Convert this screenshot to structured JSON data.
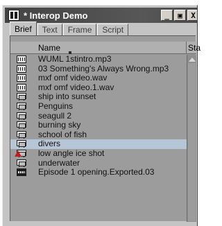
{
  "window": {
    "title": "* Interop Demo",
    "buttons": {
      "minimize": "_",
      "maximize": "▣",
      "close": "X"
    }
  },
  "tabs": [
    {
      "label": "Brief",
      "active": true
    },
    {
      "label": "Text",
      "active": false
    },
    {
      "label": "Frame",
      "active": false
    },
    {
      "label": "Script",
      "active": false
    }
  ],
  "columns": {
    "name": "Name",
    "status": "Sta"
  },
  "rows": [
    {
      "label": "WUML 1stintro.mp3",
      "icon": "audio-clip-icon",
      "selected": false
    },
    {
      "label": "03 Something's Always Wrong.mp3",
      "icon": "audio-clip-icon",
      "selected": false
    },
    {
      "label": "mxf omf video.wav",
      "icon": "audio-clip-icon",
      "selected": false
    },
    {
      "label": "mxf omf video.1.wav",
      "icon": "audio-clip-icon",
      "selected": false
    },
    {
      "label": "ship into sunset",
      "icon": "video-clip-icon",
      "selected": false
    },
    {
      "label": "Penguins",
      "icon": "video-clip-icon",
      "selected": false
    },
    {
      "label": "seagull 2",
      "icon": "video-clip-icon",
      "selected": false
    },
    {
      "label": "burning sky",
      "icon": "video-clip-icon",
      "selected": false
    },
    {
      "label": "school of fish",
      "icon": "video-clip-icon",
      "selected": false
    },
    {
      "label": "divers",
      "icon": "video-clip-icon",
      "selected": true
    },
    {
      "label": "low angle ice shot",
      "icon": "video-clip-offline-icon",
      "selected": false
    },
    {
      "label": "underwater",
      "icon": "video-clip-icon",
      "selected": false
    },
    {
      "label": "Episode 1 opening.Exported.03",
      "icon": "sequence-icon",
      "selected": false
    }
  ],
  "colors": {
    "selection": "#b7c6d6",
    "titlebar": "#4a4a4a",
    "panel": "#9c9c9c",
    "warning": "#c21b1b"
  }
}
